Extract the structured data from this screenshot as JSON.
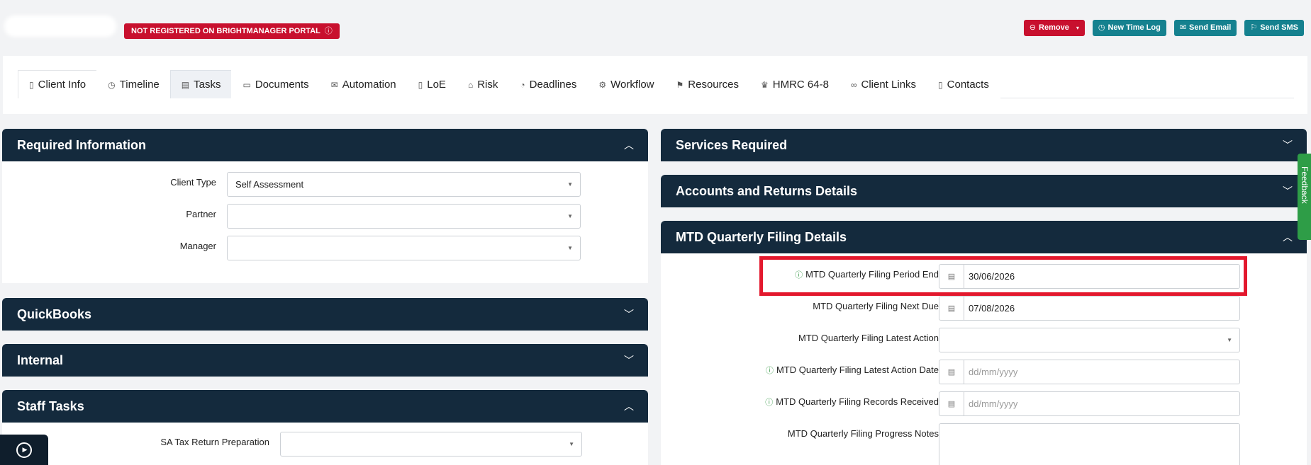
{
  "header": {
    "status_badge": "NOT REGISTERED ON BRIGHTMANAGER PORTAL",
    "actions": {
      "remove": "Remove",
      "new_time_log": "New Time Log",
      "send_email": "Send Email",
      "send_sms": "Send SMS"
    }
  },
  "tabs": [
    {
      "label": "Client Info",
      "icon": "document-icon"
    },
    {
      "label": "Timeline",
      "icon": "clock-icon"
    },
    {
      "label": "Tasks",
      "icon": "clipboard-icon",
      "active": true
    },
    {
      "label": "Documents",
      "icon": "folder-icon"
    },
    {
      "label": "Automation",
      "icon": "envelope-icon"
    },
    {
      "label": "LoE",
      "icon": "document-icon"
    },
    {
      "label": "Risk",
      "icon": "bank-icon"
    },
    {
      "label": "Deadlines",
      "icon": "alarm-icon"
    },
    {
      "label": "Workflow",
      "icon": "gear-icon"
    },
    {
      "label": "Resources",
      "icon": "bookmark-icon"
    },
    {
      "label": "HMRC 64-8",
      "icon": "crown-icon"
    },
    {
      "label": "Client Links",
      "icon": "link-icon"
    },
    {
      "label": "Contacts",
      "icon": "document-icon"
    }
  ],
  "required_information": {
    "title": "Required Information",
    "client_type_label": "Client Type",
    "client_type_value": "Self Assessment",
    "partner_label": "Partner",
    "partner_value": "",
    "manager_label": "Manager",
    "manager_value": ""
  },
  "quickbooks": {
    "title": "QuickBooks"
  },
  "internal": {
    "title": "Internal"
  },
  "staff_tasks": {
    "title": "Staff Tasks",
    "sa_tax_label": "SA Tax Return Preparation",
    "sa_tax_value": ""
  },
  "services_required": {
    "title": "Services Required"
  },
  "accounts_returns": {
    "title": "Accounts and Returns Details"
  },
  "mtd": {
    "title": "MTD Quarterly Filing Details",
    "period_end_label": "MTD Quarterly Filing Period End",
    "period_end_value": "30/06/2026",
    "next_due_label": "MTD Quarterly Filing Next Due",
    "next_due_value": "07/08/2026",
    "latest_action_label": "MTD Quarterly Filing Latest Action",
    "latest_action_value": "",
    "latest_action_date_label": "MTD Quarterly Filing Latest Action Date",
    "latest_action_date_placeholder": "dd/mm/yyyy",
    "records_received_label": "MTD Quarterly Filing Records Received",
    "records_received_placeholder": "dd/mm/yyyy",
    "progress_notes_label": "MTD Quarterly Filing Progress Notes"
  },
  "feedback": {
    "label": "Feedback"
  },
  "colors": {
    "panel_header": "#142a3d",
    "danger": "#c8102e",
    "teal": "#15818f",
    "highlight": "#e3182d",
    "feedback": "#2e9d47"
  }
}
